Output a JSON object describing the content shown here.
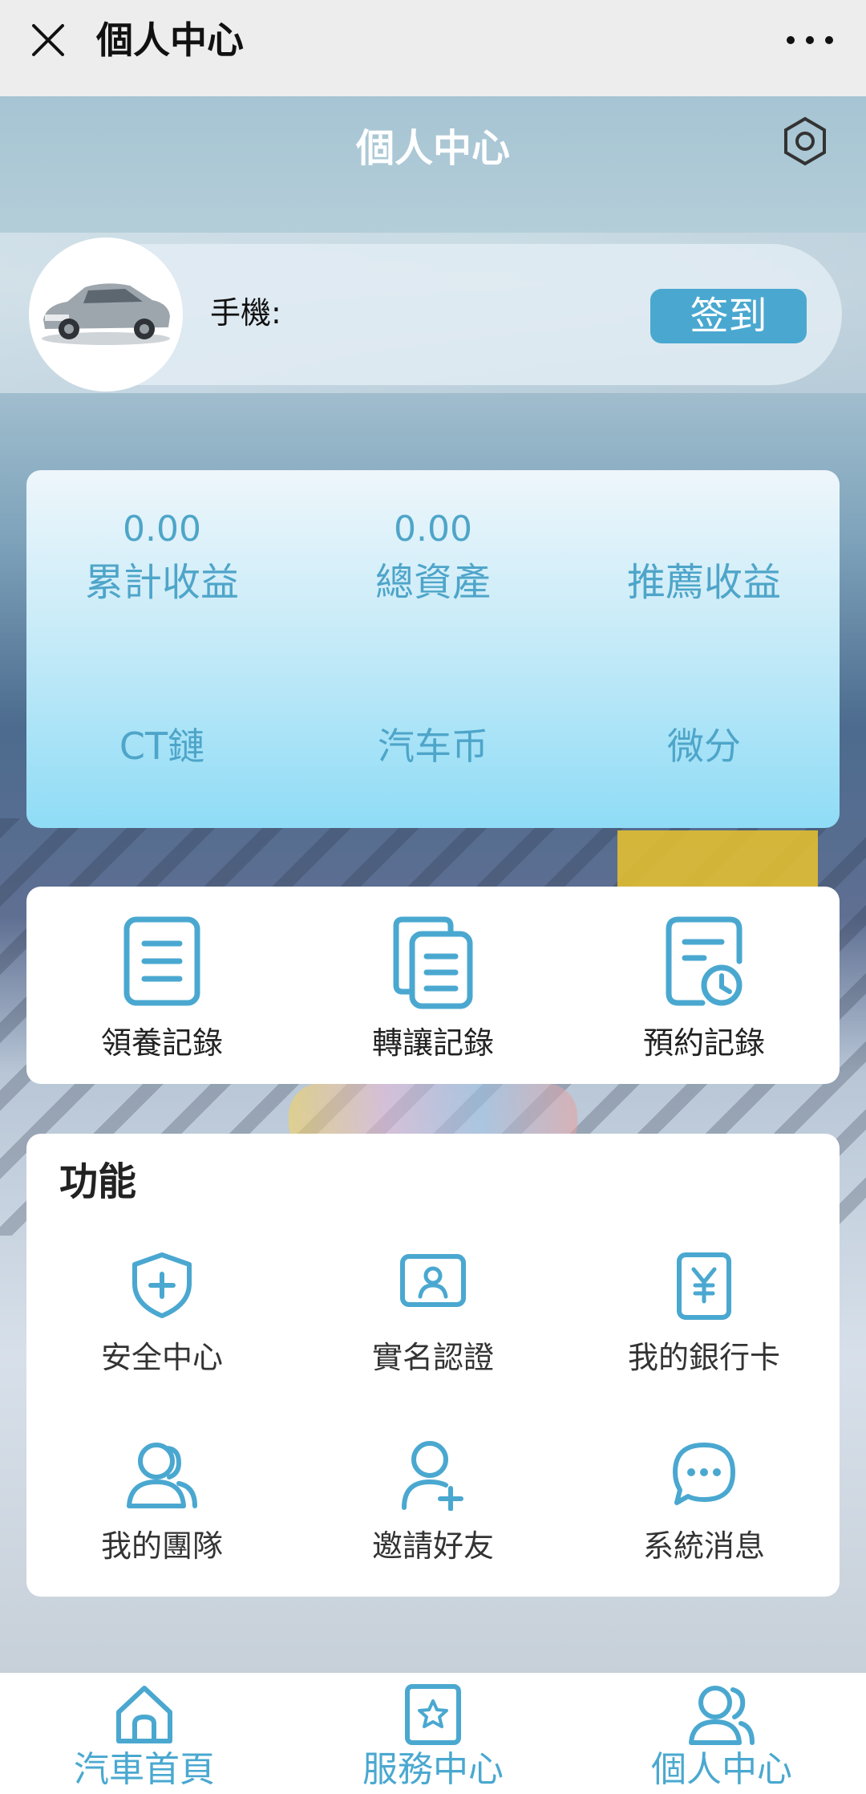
{
  "topbar": {
    "title": "個人中心"
  },
  "header": {
    "title": "個人中心"
  },
  "profile": {
    "phone_label": "手機:",
    "checkin_label": "签到"
  },
  "stats": [
    {
      "value": "0.00",
      "label": "累計收益"
    },
    {
      "value": "0.00",
      "label": "總資產"
    },
    {
      "value": "",
      "label": "推薦收益"
    },
    {
      "value": "",
      "label": "CT鏈"
    },
    {
      "value": "",
      "label": "汽车币"
    },
    {
      "value": "",
      "label": "微分"
    }
  ],
  "records": [
    {
      "label": "領養記錄",
      "icon": "document-icon"
    },
    {
      "label": "轉讓記錄",
      "icon": "documents-copy-icon"
    },
    {
      "label": "預約記錄",
      "icon": "document-clock-icon"
    }
  ],
  "functions": {
    "title": "功能",
    "items": [
      {
        "label": "安全中心",
        "icon": "shield-icon"
      },
      {
        "label": "實名認證",
        "icon": "id-card-icon"
      },
      {
        "label": "我的銀行卡",
        "icon": "bank-card-icon"
      },
      {
        "label": "我的團隊",
        "icon": "team-icon"
      },
      {
        "label": "邀請好友",
        "icon": "add-user-icon"
      },
      {
        "label": "系統消息",
        "icon": "message-icon"
      }
    ]
  },
  "tabbar": [
    {
      "label": "汽車首頁",
      "icon": "home-icon"
    },
    {
      "label": "服務中心",
      "icon": "star-bookmark-icon"
    },
    {
      "label": "個人中心",
      "icon": "user-group-icon"
    }
  ],
  "colors": {
    "accent": "#4aa8d0",
    "stat_text": "#4ea5c9"
  }
}
